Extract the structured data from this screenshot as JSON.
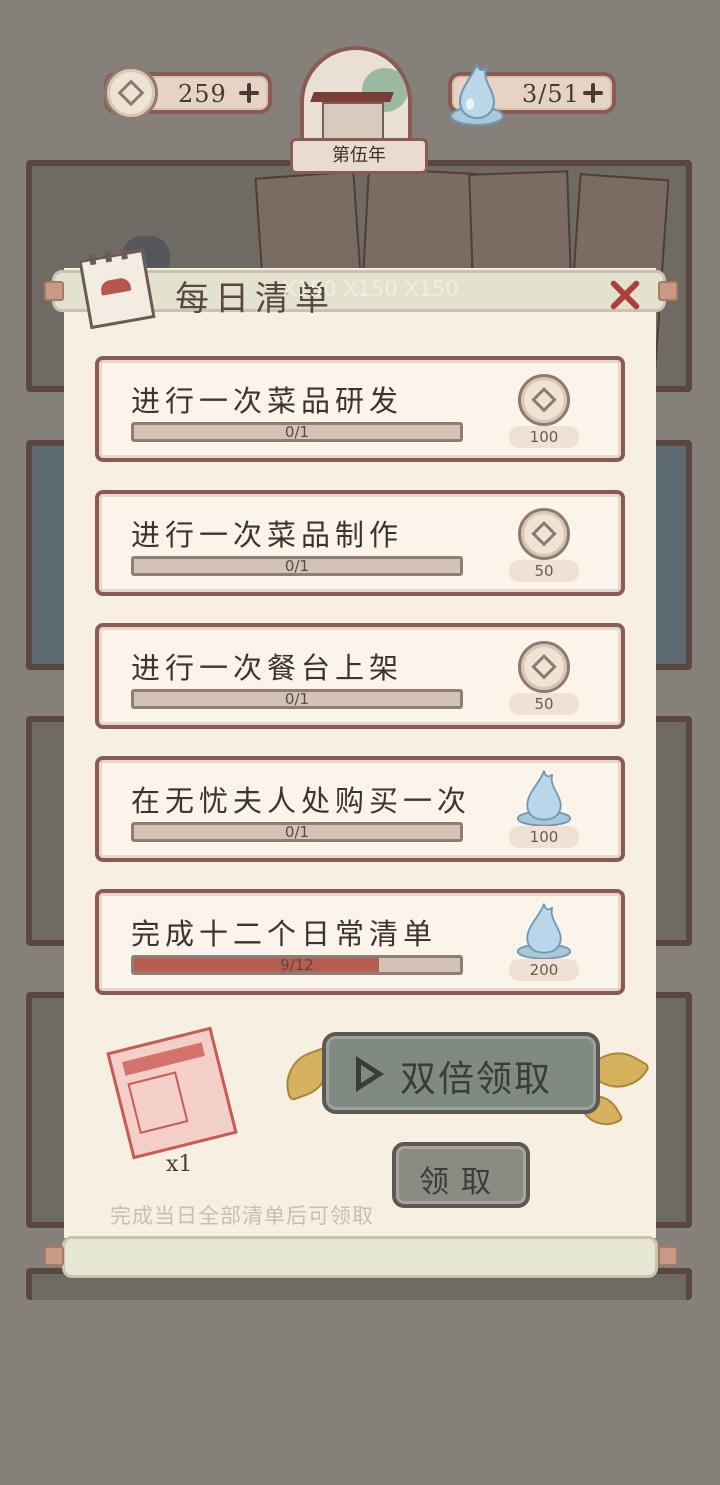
{
  "resources": {
    "coins": "259",
    "water": "3/51"
  },
  "year_label": "第伍年",
  "panel": {
    "title": "每日清单",
    "overlay_text": "X150 X150 X150"
  },
  "tasks": [
    {
      "name": "进行一次菜品研发",
      "progress": "0/1",
      "fraction": 0.0,
      "reward_icon": "coin-icon",
      "reward": "100"
    },
    {
      "name": "进行一次菜品制作",
      "progress": "0/1",
      "fraction": 0.0,
      "reward_icon": "coin-icon",
      "reward": "50"
    },
    {
      "name": "进行一次餐台上架",
      "progress": "0/1",
      "fraction": 0.0,
      "reward_icon": "coin-icon",
      "reward": "50"
    },
    {
      "name": "在无忧夫人处购买一次",
      "progress": "0/1",
      "fraction": 0.0,
      "reward_icon": "water-drop-icon",
      "reward": "100"
    },
    {
      "name": "完成十二个日常清单",
      "progress": "9/12",
      "fraction": 0.75,
      "reward_icon": "water-drop-icon",
      "reward": "200"
    }
  ],
  "bonus": {
    "quantity": "x1"
  },
  "buttons": {
    "double_claim": "双倍领取",
    "claim": "领取"
  },
  "hint": "完成当日全部清单后可领取",
  "colors": {
    "frame": "#8a5b52",
    "progress_fill": "#b75d52",
    "button": "#7f8a83"
  }
}
